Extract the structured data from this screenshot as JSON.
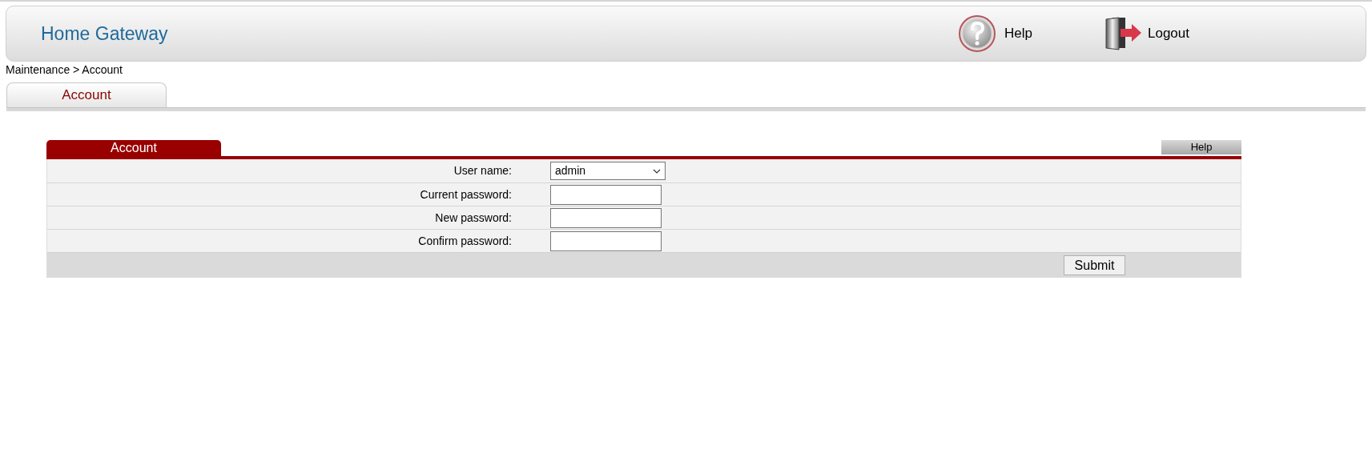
{
  "header": {
    "title": "Home Gateway",
    "help": "Help",
    "logout": "Logout"
  },
  "breadcrumb": "Maintenance > Account",
  "tabs": [
    {
      "label": "Account",
      "selected": true
    }
  ],
  "panel": {
    "title": "Account",
    "help": "Help",
    "rows": [
      {
        "kind": "select",
        "label": "User name:",
        "value": "admin"
      },
      {
        "kind": "password",
        "label": "Current password:"
      },
      {
        "kind": "password",
        "label": "New password:"
      },
      {
        "kind": "password",
        "label": "Confirm password:"
      }
    ],
    "submit": "Submit"
  }
}
